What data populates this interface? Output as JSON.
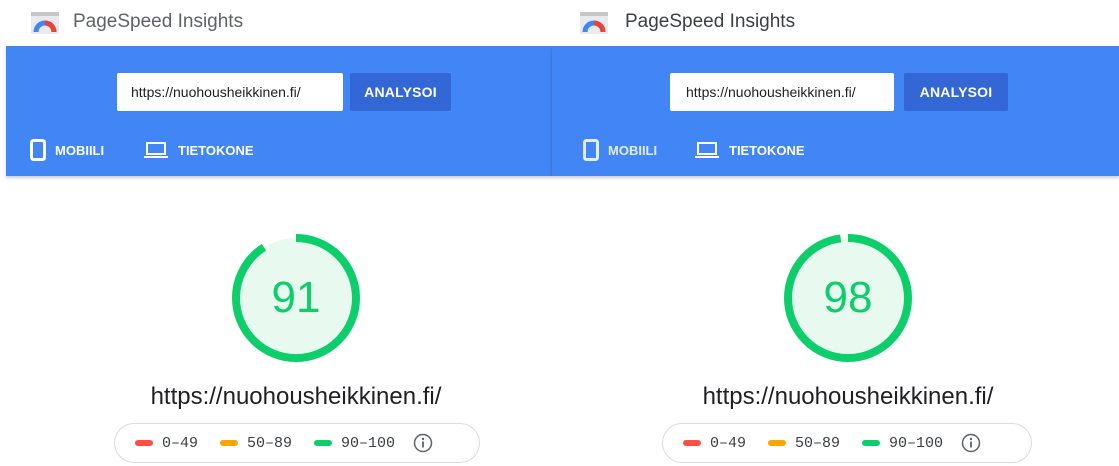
{
  "colors": {
    "header_blue": "#4285f4",
    "button_blue": "#3367d6",
    "score_green": "#0cce6b",
    "fail_red": "#ff4e42",
    "average_orange": "#ffa400"
  },
  "panels": [
    {
      "app_title": "PageSpeed Insights",
      "url_input_value": "https://nuohousheikkinen.fi/",
      "analyze_label": "ANALYSOI",
      "tab_mobile": "MOBIILI",
      "tab_desktop": "TIETOKONE",
      "score": 91,
      "score_label": "91",
      "analyzed_url": "https://nuohousheikkinen.fi/",
      "legend": {
        "fail": "0–49",
        "average": "50–89",
        "pass": "90–100"
      },
      "icons": [
        "pagespeed-logo-icon",
        "phone-icon",
        "laptop-icon",
        "info-icon"
      ]
    },
    {
      "app_title": "PageSpeed Insights",
      "url_input_value": "https://nuohousheikkinen.fi/",
      "analyze_label": "ANALYSOI",
      "tab_mobile": "MOBIILI",
      "tab_desktop": "TIETOKONE",
      "score": 98,
      "score_label": "98",
      "analyzed_url": "https://nuohousheikkinen.fi/",
      "legend": {
        "fail": "0–49",
        "average": "50–89",
        "pass": "90–100"
      },
      "icons": [
        "pagespeed-logo-icon",
        "phone-icon",
        "laptop-icon",
        "info-icon"
      ]
    }
  ]
}
